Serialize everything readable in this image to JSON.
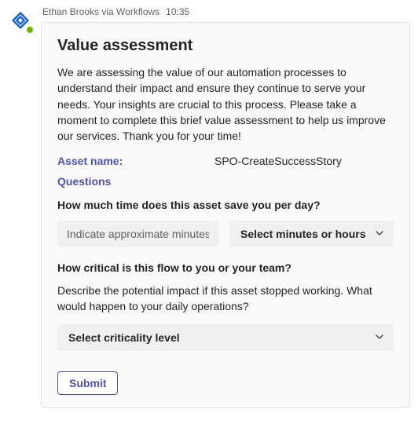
{
  "meta": {
    "sender": "Ethan Brooks via Workflows",
    "time": "10:35"
  },
  "card": {
    "title": "Value assessment",
    "description": "We are assessing the value of our automation processes to understand their impact and ensure they continue to serve your needs. Your insights are crucial to this process. Please take a moment to complete this brief value assessment to help us improve our services. Thank you for your time!",
    "asset_label": "Asset name:",
    "asset_value": "SPO-CreateSuccessStory",
    "questions_label": "Questions",
    "q1": {
      "text": "How much time does this asset save you per day?",
      "input_placeholder": "Indicate approximate minutes",
      "select_label": "Select minutes or hours"
    },
    "q2": {
      "text": "How critical is this flow to you or your team?",
      "subtext": "Describe the potential impact if this asset stopped working. What would happen to your daily operations?",
      "select_label": "Select criticality level"
    },
    "submit_label": "Submit"
  }
}
